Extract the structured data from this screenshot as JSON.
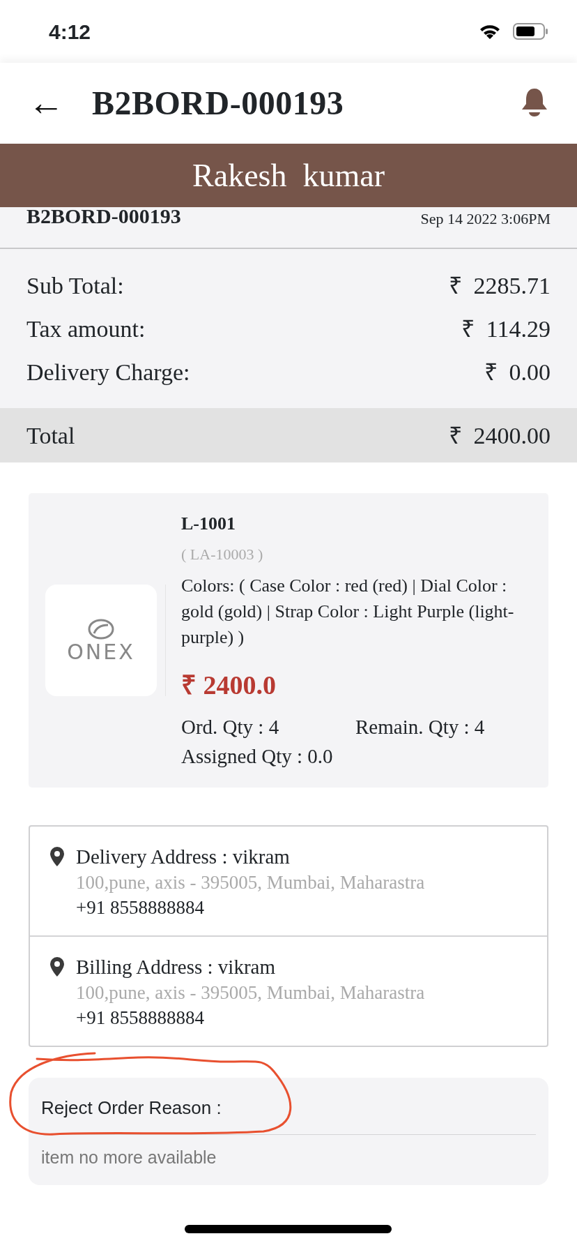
{
  "status_bar": {
    "time": "4:12"
  },
  "header": {
    "back": "←",
    "title": "B2BORD-000193"
  },
  "banner": {
    "name": "Rakesh  kumar"
  },
  "order": {
    "number": "B2BORD-000193",
    "date": "Sep 14 2022  3:06PM"
  },
  "summary": [
    {
      "label": "Sub Total:",
      "currency": "₹",
      "amount": "2285.71"
    },
    {
      "label": "Tax amount:",
      "currency": "₹",
      "amount": "114.29"
    },
    {
      "label": "Delivery Charge:",
      "currency": "₹",
      "amount": "0.00"
    }
  ],
  "total": {
    "label": "Total",
    "currency": "₹",
    "amount": "2400.00"
  },
  "product": {
    "logo_text": "ONEX",
    "name": "L-1001",
    "code": "( LA-10003 )",
    "colors": "Colors:  ( Case Color : red (red) | Dial Color : gold (gold) | Strap Color : Light Purple (light-purple) )",
    "price": "₹ 2400.0",
    "ordered_qty": "Ord. Qty : 4",
    "remaining_qty": "Remain. Qty : 4",
    "assigned_qty": "Assigned Qty : 0.0"
  },
  "addresses": [
    {
      "title": "Delivery Address : vikram",
      "address": "100,pune, axis -  395005, Mumbai, Maharastra",
      "phone": "+91 8558888884"
    },
    {
      "title": "Billing Address : vikram",
      "address": "100,pune, axis -  395005, Mumbai, Maharastra",
      "phone": "+91 8558888884"
    }
  ],
  "reject": {
    "label": "Reject Order Reason :",
    "reason": "item no more available"
  }
}
